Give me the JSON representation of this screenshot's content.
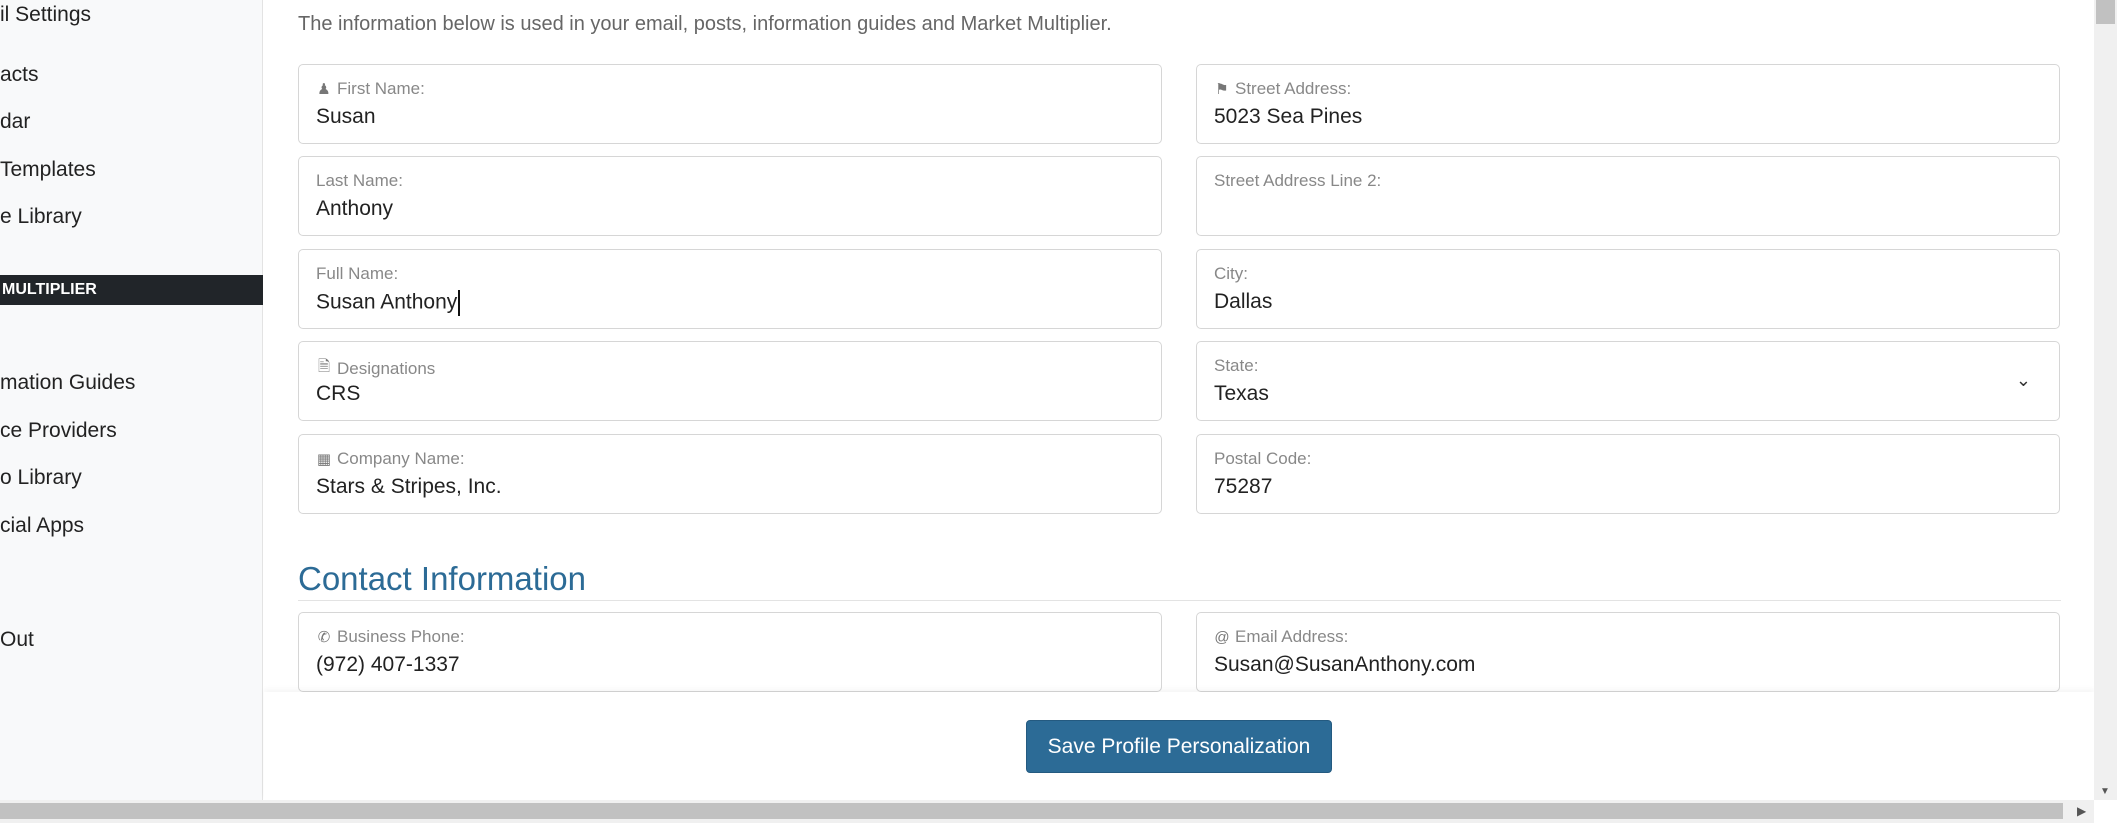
{
  "sidebar": {
    "items": [
      "il Settings",
      "acts",
      "dar",
      " Templates",
      "e Library",
      "mation Guides",
      "ce Providers",
      "o Library",
      "cial Apps",
      "Out"
    ],
    "section": "MULTIPLIER"
  },
  "intro": "The information below is used in your email, posts, information guides and Market Multiplier.",
  "left_fields": [
    {
      "label": "First Name:",
      "value": "Susan",
      "icon": "user-icon"
    },
    {
      "label": "Last Name:",
      "value": "Anthony"
    },
    {
      "label": "Full Name:",
      "value": "Susan Anthony"
    },
    {
      "label": "Designations",
      "value": "CRS",
      "icon": "id-card-icon"
    },
    {
      "label": "Company Name:",
      "value": "Stars & Stripes, Inc.",
      "icon": "building-icon"
    }
  ],
  "right_fields": [
    {
      "label": "Street Address:",
      "value": "5023 Sea Pines",
      "icon": "map-marker-icon"
    },
    {
      "label": "Street Address Line 2:",
      "value": ""
    },
    {
      "label": "City:",
      "value": "Dallas"
    },
    {
      "label": "State:",
      "value": "Texas"
    },
    {
      "label": "Postal Code:",
      "value": "75287"
    }
  ],
  "contact": {
    "heading": "Contact Information",
    "phone": {
      "label": "Business Phone:",
      "value": "(972) 407-1337",
      "icon": "phone-icon"
    },
    "email": {
      "label": "Email Address:",
      "value": "Susan@SusanAnthony.com",
      "icon": "at-icon"
    }
  },
  "footer": {
    "save_label": "Save Profile Personalization"
  },
  "colors": {
    "accent": "#2c6b96",
    "section_bar": "#212529"
  }
}
